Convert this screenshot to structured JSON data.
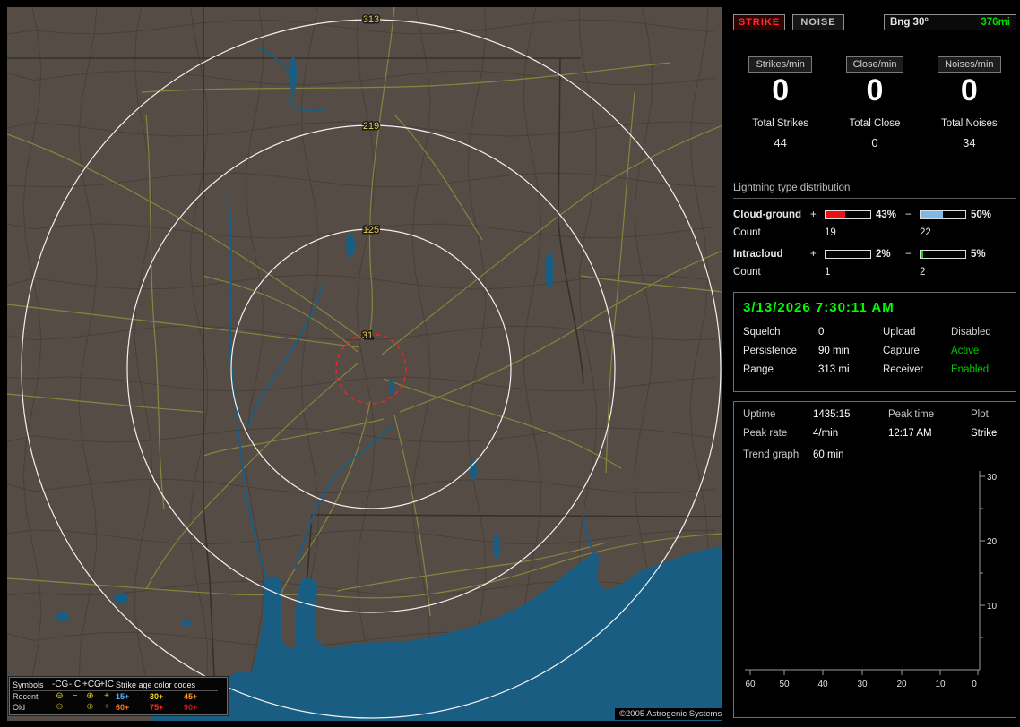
{
  "map": {
    "range_labels": [
      "313",
      "219",
      "125",
      "31"
    ],
    "copyright": "©2005 Astrogenic Systems",
    "legend": {
      "symbols_title": "Symbols",
      "columns": [
        "-CG",
        "-IC",
        "+CG",
        "+IC"
      ],
      "age_title": "Strike age color codes",
      "rows": [
        {
          "label": "Recent",
          "symbols": [
            "⊖",
            "−",
            "⊕",
            "+"
          ],
          "symbol_color": "#d6cc2e",
          "ages": [
            {
              "t": "15+",
              "c": "#58b0ff"
            },
            {
              "t": "30+",
              "c": "#ffd800"
            },
            {
              "t": "45+",
              "c": "#ff9520"
            }
          ]
        },
        {
          "label": "Old",
          "symbols": [
            "⊖",
            "−",
            "⊕",
            "+"
          ],
          "symbol_color": "#9a9220",
          "ages": [
            {
              "t": "60+",
              "c": "#ff7820"
            },
            {
              "t": "75+",
              "c": "#ff3020"
            },
            {
              "t": "90+",
              "c": "#cf1414"
            }
          ]
        }
      ]
    }
  },
  "panel": {
    "strike_button": "STRIKE",
    "noise_button": "NOISE",
    "bearing_label": "Bng 30°",
    "bearing_value": "376mi",
    "bearing_value_color": "#00dd00",
    "counters": [
      {
        "label": "Strikes/min",
        "value": "0",
        "total_label": "Total Strikes",
        "total": "44"
      },
      {
        "label": "Close/min",
        "value": "0",
        "total_label": "Total Close",
        "total": "0"
      },
      {
        "label": "Noises/min",
        "value": "0",
        "total_label": "Total Noises",
        "total": "34"
      }
    ],
    "distribution": {
      "title": "Lightning type distribution",
      "rows": [
        {
          "name": "Cloud-ground",
          "pos_sign": "+",
          "pos_fill": 43,
          "pos_color": "#ee1010",
          "pos_pct": "43%",
          "neg_sign": "−",
          "neg_fill": 50,
          "neg_color": "#7cb8ea",
          "neg_pct": "50%",
          "count_label": "Count",
          "pos_count": "19",
          "neg_count": "22"
        },
        {
          "name": "Intracloud",
          "pos_sign": "+",
          "pos_fill": 2,
          "pos_color": "#ee1010",
          "pos_pct": "2%",
          "neg_sign": "−",
          "neg_fill": 5,
          "neg_color": "#18c018",
          "neg_pct": "5%",
          "count_label": "Count",
          "pos_count": "1",
          "neg_count": "2"
        }
      ]
    },
    "status": {
      "datetime": "3/13/2026 7:30:11 AM",
      "rows": [
        {
          "k1": "Squelch",
          "v1": "0",
          "k2": "Upload",
          "v2": "Disabled",
          "v2_color": "#cfcfcf"
        },
        {
          "k1": "Persistence",
          "v1": "90 min",
          "k2": "Capture",
          "v2": "Active",
          "v2_color": "#00cc00"
        },
        {
          "k1": "Range",
          "v1": "313 mi",
          "k2": "Receiver",
          "v2": "Enabled",
          "v2_color": "#00cc00"
        }
      ]
    },
    "stats": {
      "uptime_label": "Uptime",
      "uptime": "1435:15",
      "peak_time_label": "Peak time",
      "peak_time": "12:17 AM",
      "plot_label": "Plot",
      "plot": "Strike",
      "peak_rate_label": "Peak rate",
      "peak_rate": "4/min",
      "trend_label": "Trend graph",
      "trend_value": "60 min"
    },
    "trend_graph": {
      "type": "line",
      "y_ticks": [
        "30",
        "20",
        "10"
      ],
      "x_ticks": [
        "60",
        "50",
        "40",
        "30",
        "20",
        "10",
        "0"
      ],
      "x_unit": "min",
      "series": []
    }
  }
}
